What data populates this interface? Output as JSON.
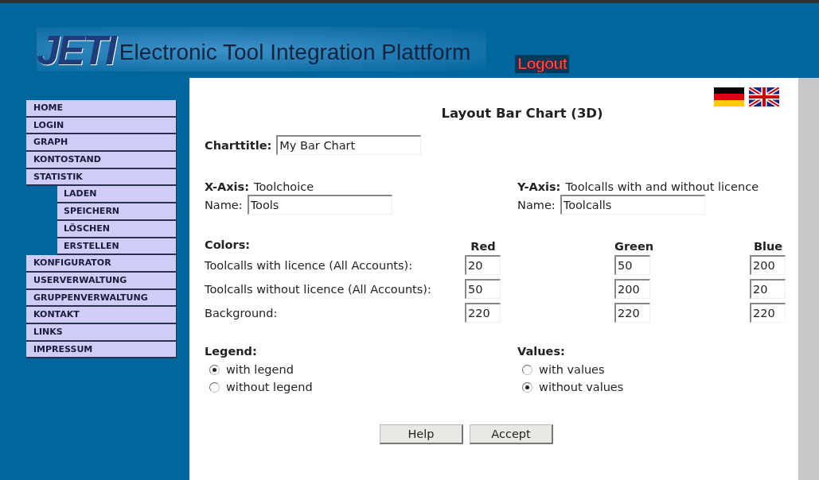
{
  "header": {
    "logo": "JETI",
    "title": "Electronic Tool Integration Plattform",
    "logout": "Logout"
  },
  "nav": [
    {
      "label": "HOME"
    },
    {
      "label": "LOGIN"
    },
    {
      "label": "GRAPH"
    },
    {
      "label": "KONTOSTAND"
    },
    {
      "label": "STATISTIK",
      "children": [
        {
          "label": "LADEN"
        },
        {
          "label": "SPEICHERN"
        },
        {
          "label": "LÖSCHEN"
        },
        {
          "label": "ERSTELLEN"
        }
      ]
    },
    {
      "label": "KONFIGURATOR"
    },
    {
      "label": "USERVERWALTUNG"
    },
    {
      "label": "GRUPPENVERWALTUNG"
    },
    {
      "label": "KONTAKT"
    },
    {
      "label": "LINKS"
    },
    {
      "label": "IMPRESSUM"
    }
  ],
  "page_title": "Layout Bar Chart (3D)",
  "chart_title": {
    "label": "Charttitle:",
    "value": "My Bar Chart"
  },
  "x_axis": {
    "label": "X-Axis:",
    "description": "Toolchoice",
    "name_label": "Name:",
    "name_value": "Tools"
  },
  "y_axis": {
    "label": "Y-Axis:",
    "description": "Toolcalls with and without licence",
    "name_label": "Name:",
    "name_value": "Toolcalls"
  },
  "colors": {
    "label": "Colors:",
    "columns": [
      "Red",
      "Green",
      "Blue"
    ],
    "rows": [
      {
        "label": "Toolcalls with licence (All Accounts):",
        "values": [
          "20",
          "50",
          "200"
        ]
      },
      {
        "label": "Toolcalls without licence (All Accounts):",
        "values": [
          "50",
          "200",
          "20"
        ]
      },
      {
        "label": "Background:",
        "values": [
          "220",
          "220",
          "220"
        ]
      }
    ]
  },
  "legend": {
    "label": "Legend:",
    "options": [
      {
        "label": "with legend",
        "selected": true
      },
      {
        "label": "without legend",
        "selected": false
      }
    ]
  },
  "values": {
    "label": "Values:",
    "options": [
      {
        "label": "with values",
        "selected": false
      },
      {
        "label": "without values",
        "selected": true
      }
    ]
  },
  "buttons": [
    "Help",
    "Accept"
  ]
}
